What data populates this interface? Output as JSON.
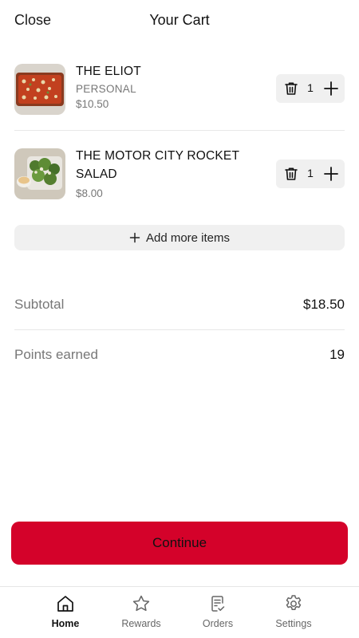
{
  "header": {
    "close_label": "Close",
    "title": "Your Cart"
  },
  "cart": {
    "items": [
      {
        "name": "THE ELIOT",
        "variant": "PERSONAL",
        "price": "$10.50",
        "quantity": "1",
        "image": "pizza-image"
      },
      {
        "name": "THE MOTOR CITY ROCKET SALAD",
        "variant": "",
        "price": "$8.00",
        "quantity": "1",
        "image": "salad-image"
      }
    ],
    "add_more_label": "Add more items"
  },
  "summary": {
    "subtotal_label": "Subtotal",
    "subtotal_value": "$18.50",
    "points_label": "Points earned",
    "points_value": "19"
  },
  "cta": {
    "continue_label": "Continue"
  },
  "tabbar": {
    "tabs": [
      {
        "label": "Home",
        "icon": "home-icon",
        "active": true
      },
      {
        "label": "Rewards",
        "icon": "star-icon",
        "active": false
      },
      {
        "label": "Orders",
        "icon": "receipt-icon",
        "active": false
      },
      {
        "label": "Settings",
        "icon": "gear-icon",
        "active": false
      }
    ]
  },
  "colors": {
    "accent": "#d4022a",
    "pill_bg": "#f0f0f0",
    "muted_text": "#777777"
  }
}
